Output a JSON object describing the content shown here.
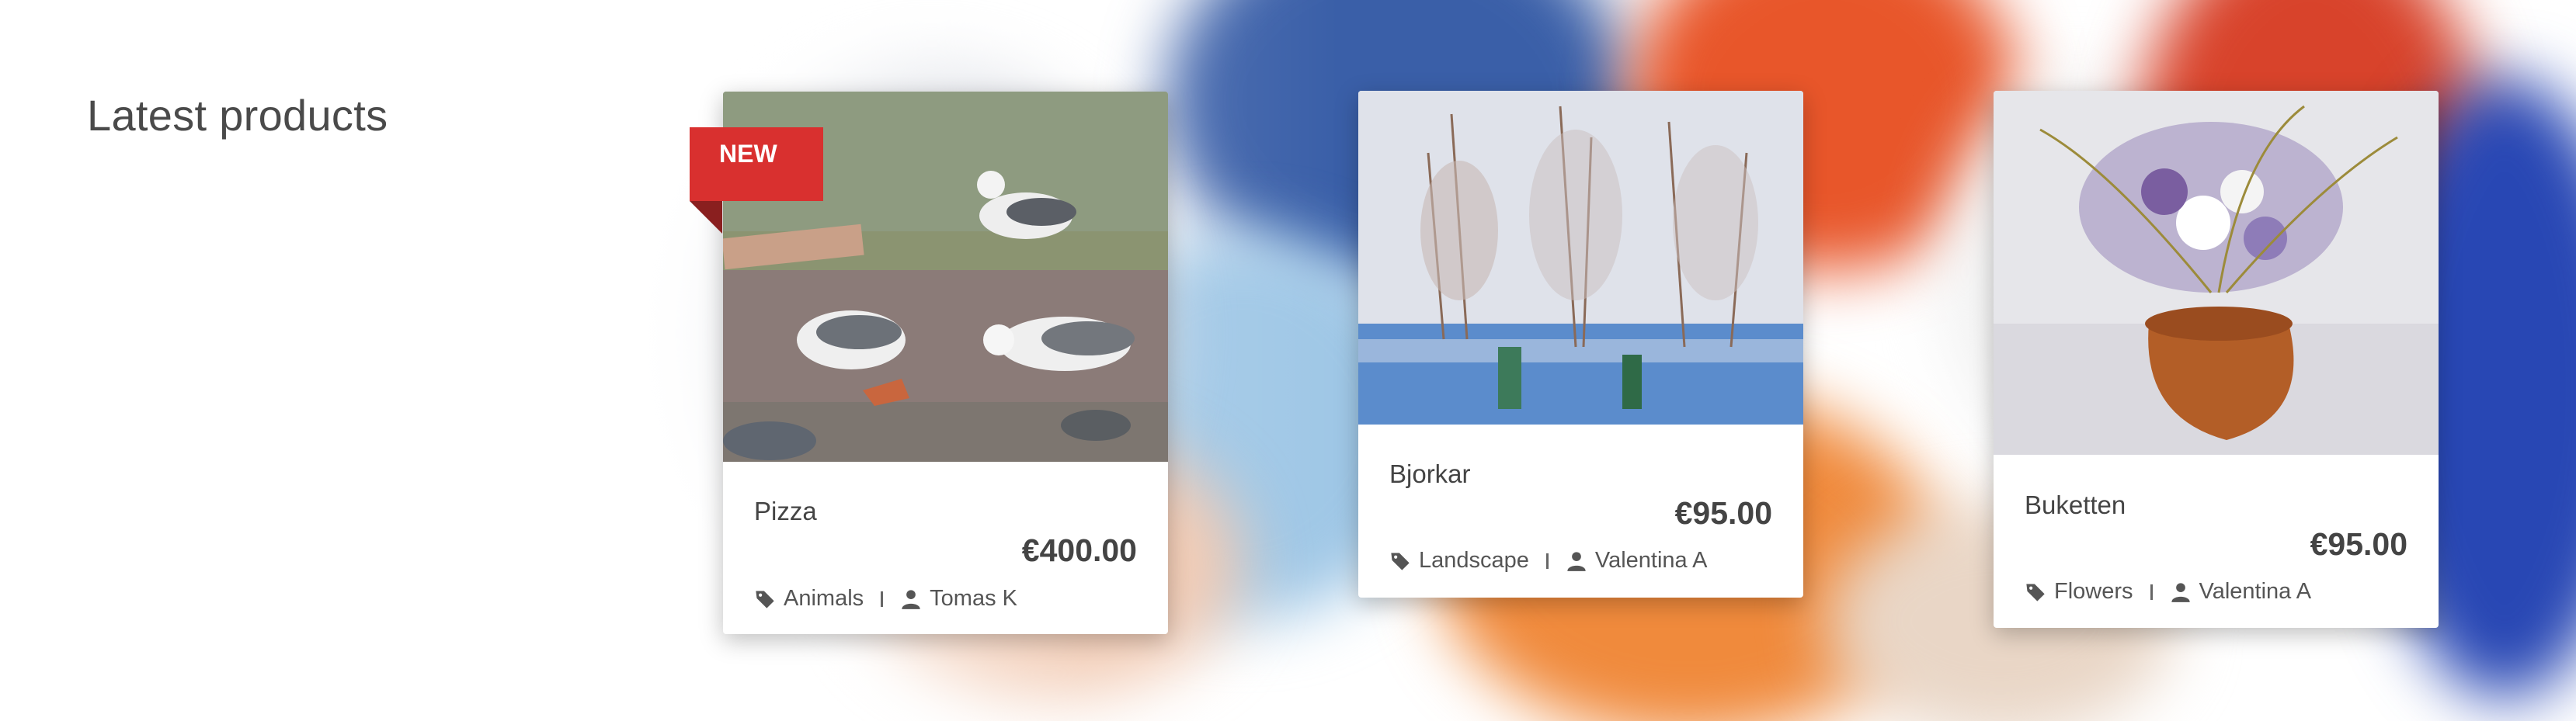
{
  "section": {
    "title": "Latest products"
  },
  "products": [
    {
      "name": "Pizza",
      "price": "€400.00",
      "category": "Animals",
      "artist": "Tomas K",
      "badge": "NEW"
    },
    {
      "name": "Bjorkar",
      "price": "€95.00",
      "category": "Landscape",
      "artist": "Valentina A"
    },
    {
      "name": "Buketten",
      "price": "€95.00",
      "category": "Flowers",
      "artist": "Valentina A"
    }
  ],
  "icons": {
    "category": "tag-icon",
    "artist": "user-icon"
  },
  "colors": {
    "badge": "#d9302f",
    "text": "#444444"
  }
}
